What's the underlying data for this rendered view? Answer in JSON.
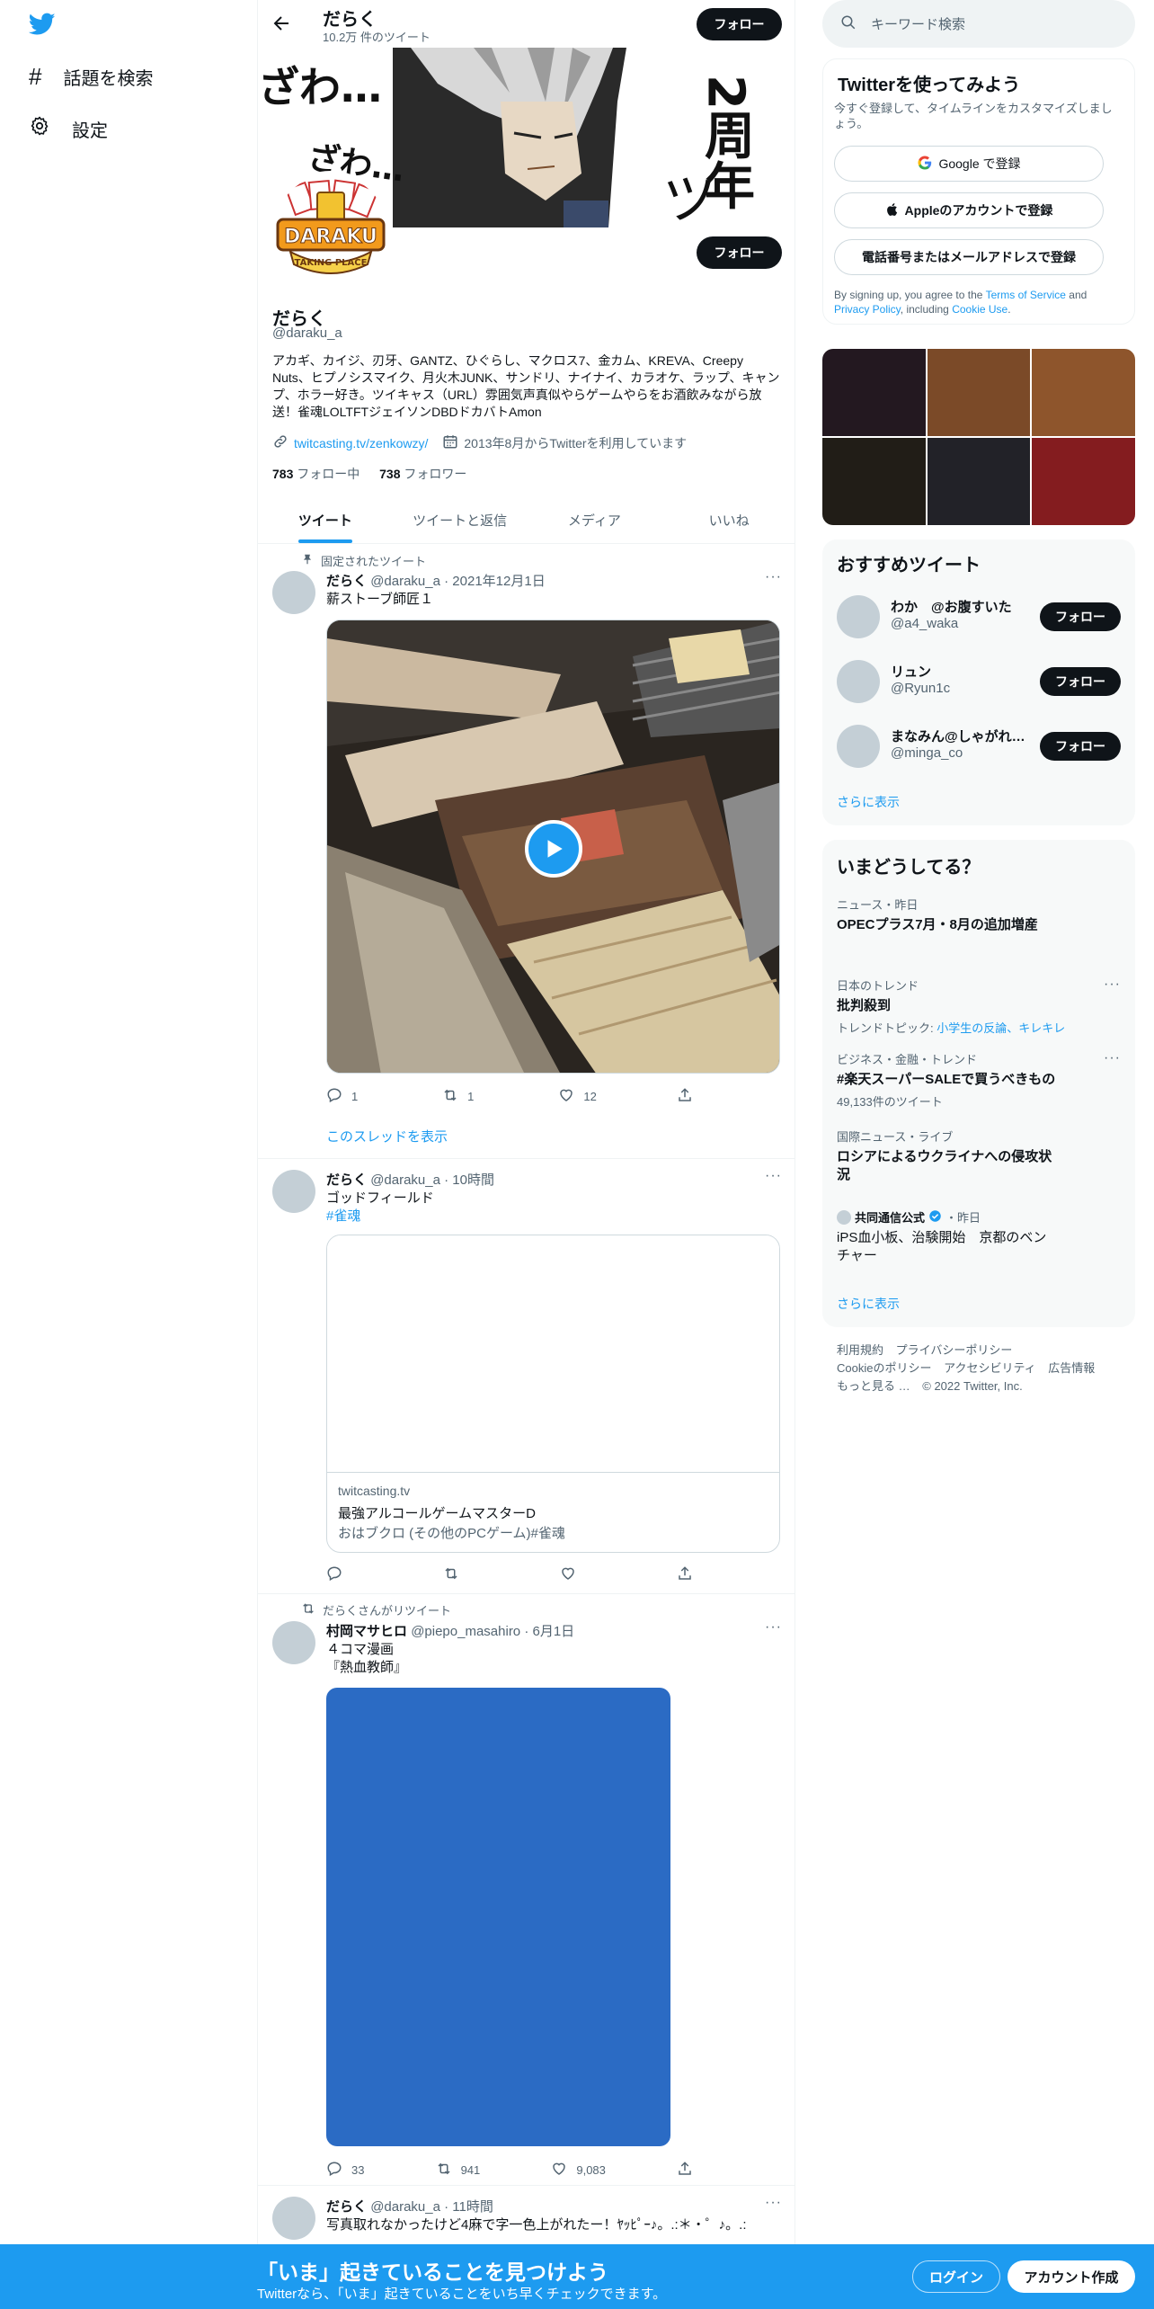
{
  "nav": {
    "explore_label": "話題を検索",
    "settings_label": "設定"
  },
  "header": {
    "name": "だらく",
    "tweet_count": "10.2万 件のツイート",
    "follow_label": "フォロー"
  },
  "banner": {
    "text_zawa": "ざわ…",
    "text_zawa2": "ざわ…",
    "text_anniv": "2周年",
    "text_tsu": "ツ",
    "logo_text": "DARAKU",
    "logo_sub": "TAKING PLACE"
  },
  "profile": {
    "follow_label": "フォロー",
    "name": "だらく",
    "handle": "@daraku_a",
    "bio": "アカギ、カイジ、刃牙、GANTZ、ひぐらし、マクロス7、金カム、KREVA、Creepy Nuts、ヒプノシスマイク、月火木JUNK、サンドリ、ナイナイ、カラオケ、ラップ、キャンプ、ホラー好き。ツイキャス（URL）雰囲気声真似やらゲームやらをお酒飲みながら放送！雀魂LOLTFTジェイソンDBDドカバトAmon",
    "link": "twitcasting.tv/zenkowzy/",
    "joined": "2013年8月からTwitterを利用しています",
    "following_count": "783",
    "following_label": "フォロー中",
    "followers_count": "738",
    "followers_label": "フォロワー"
  },
  "tabs": [
    "ツイート",
    "ツイートと返信",
    "メディア",
    "いいね"
  ],
  "tweets": [
    {
      "pinned_label": "固定されたツイート",
      "name": "だらく",
      "meta": "@daraku_a · 2021年12月1日",
      "text": "薪ストーブ師匠１",
      "replies": "1",
      "retweets": "1",
      "likes": "12",
      "thread_link": "このスレッドを表示"
    },
    {
      "name": "だらく",
      "meta": "@daraku_a · 10時間",
      "text": "ゴッドフィールド",
      "hashtag": "#雀魂",
      "card_domain": "twitcasting.tv",
      "card_title": "最強アルコールゲームマスターD",
      "card_desc": "おはブクロ (その他のPCゲーム)#雀魂"
    },
    {
      "retweet_label": "だらくさんがリツイート",
      "name": "村岡マサヒロ",
      "meta": "@piepo_masahiro · 6月1日",
      "text1": "４コマ漫画",
      "text2": "『熱血教師』",
      "replies": "33",
      "retweets": "941",
      "likes": "9,083"
    },
    {
      "name": "だらく",
      "meta": "@daraku_a · 11時間",
      "text": "写真取れなかったけど4麻で字一色上がれたー！ﾔｯﾋﾟｰ♪。.:＊・゜♪。.:"
    }
  ],
  "search": {
    "placeholder": "キーワード検索"
  },
  "signup_card": {
    "title": "Twitterを使ってみよう",
    "subtitle": "今すぐ登録して、タイムラインをカスタマイズしましょう。",
    "google": "Google で登録",
    "apple": "Appleのアカウントで登録",
    "phone": "電話番号またはメールアドレスで登録",
    "terms_pre": "By signing up, you agree to the",
    "terms_link": "Terms of Service",
    "terms_and": "and",
    "privacy_link": "Privacy Policy",
    "terms_mid": ", including",
    "cookie_link": "Cookie Use",
    "terms_end": "."
  },
  "media_colors": [
    "#231820",
    "#7b4a28",
    "#8e552c",
    "#211d17",
    "#222228",
    "#841c1f"
  ],
  "recommend": {
    "title": "おすすめツイート",
    "users": [
      {
        "name": "わか　@お腹すいた",
        "handle": "@a4_waka",
        "follow": "フォロー"
      },
      {
        "name": "リュン",
        "handle": "@Ryun1c",
        "follow": "フォロー"
      },
      {
        "name": "まなみん@しゃがれ声Vtuber",
        "handle": "@minga_co",
        "follow": "フォロー"
      }
    ],
    "more": "さらに表示"
  },
  "trends": {
    "title": "いまどうしてる？",
    "items": [
      {
        "context": "ニュース・昨日",
        "topic": "OPECプラス7月・8月の追加増産"
      },
      {
        "context": "日本のトレンド",
        "topic": "批判殺到",
        "sub_pre": "トレンドトピック:",
        "sub_links": "小学生の反論、キレキレ"
      },
      {
        "context": "ビジネス・金融・トレンド",
        "topic": "#楽天スーパーSALEで買うべきもの",
        "sub": "49,133件のツイート"
      },
      {
        "context": "国際ニュース・ライブ",
        "topic": "ロシアによるウクライナへの侵攻状況"
      },
      {
        "context_name": "共同通信公式",
        "context_time": "・昨日",
        "topic": "iPS血小板、治験開始　京都のベンチャー"
      }
    ],
    "more": "さらに表示"
  },
  "footer": {
    "links": [
      "利用規約",
      "プライバシーポリシー",
      "Cookieのポリシー",
      "アクセシビリティ",
      "広告情報",
      "もっと見る …"
    ],
    "copyright": "© 2022 Twitter, Inc."
  },
  "bottombar": {
    "title": "「いま」起きていることを見つけよう",
    "subtitle": "Twitterなら、「いま」起きていることをいち早くチェックできます。",
    "login": "ログイン",
    "signup": "アカウント作成"
  },
  "colors": {
    "accent": "#1d9bf0",
    "dark": "#0f1419",
    "muted": "#536471"
  }
}
